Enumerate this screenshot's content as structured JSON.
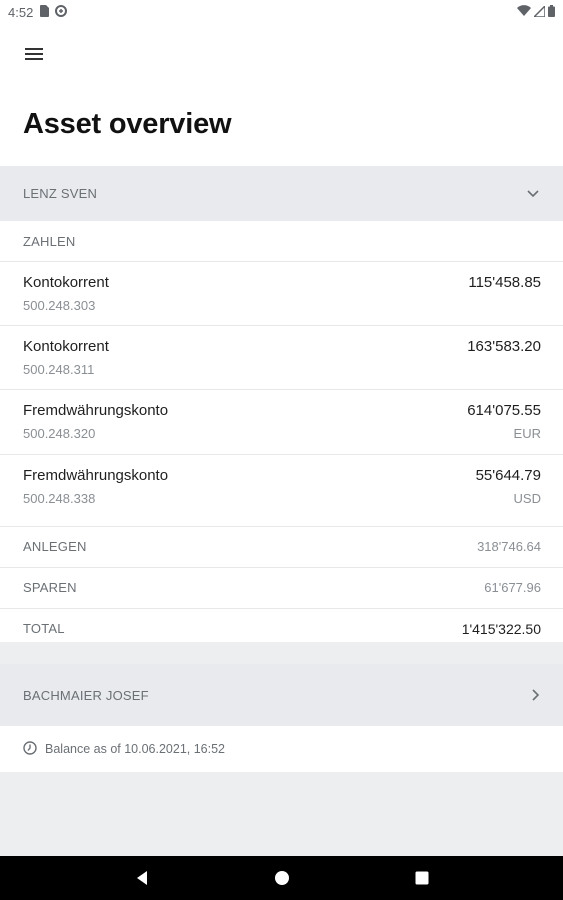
{
  "status_bar": {
    "time": "4:52",
    "icons_left": [
      "sim-card-icon",
      "data-saver-icon"
    ],
    "icons_right": [
      "wifi-icon",
      "signal-icon",
      "battery-icon"
    ]
  },
  "header": {
    "menu_icon": "hamburger-menu-icon",
    "title": "Asset overview"
  },
  "groups": [
    {
      "name": "LENZ SVEN",
      "expanded": true,
      "category": "ZAHLEN",
      "accounts": [
        {
          "name": "Kontokorrent",
          "number": "500.248.303",
          "amount": "115'458.85",
          "currency": ""
        },
        {
          "name": "Kontokorrent",
          "number": "500.248.311",
          "amount": "163'583.20",
          "currency": ""
        },
        {
          "name": "Fremdwährungskonto",
          "number": "500.248.320",
          "amount": "614'075.55",
          "currency": "EUR"
        },
        {
          "name": "Fremdwährungskonto",
          "number": "500.248.338",
          "amount": "55'644.79",
          "currency": "USD"
        }
      ],
      "summary": [
        {
          "label": "ANLEGEN",
          "value": "318'746.64"
        },
        {
          "label": "SPAREN",
          "value": "61'677.96"
        },
        {
          "label": "TOTAL",
          "value": "1'415'322.50"
        }
      ]
    },
    {
      "name": "BACHMAIER JOSEF",
      "expanded": false
    }
  ],
  "balance_note": "Balance as of 10.06.2021, 16:52",
  "nav": {
    "back_icon": "back-triangle-icon",
    "home_icon": "home-circle-icon",
    "recents_icon": "recents-square-icon"
  },
  "colors": {
    "section_bg": "#e8eaed",
    "card_bg": "#ffffff",
    "nav_bg": "#000000"
  }
}
